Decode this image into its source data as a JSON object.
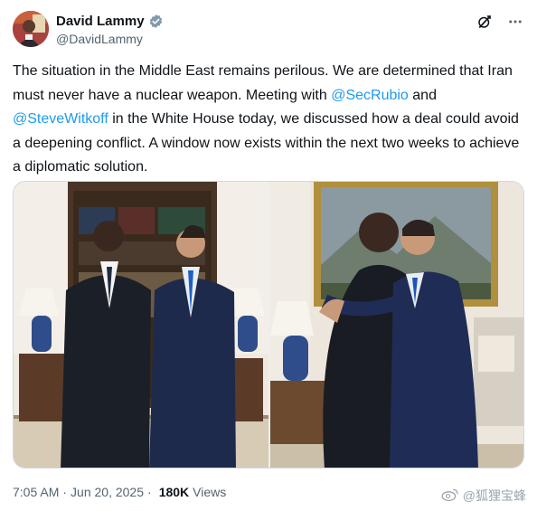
{
  "author": {
    "display_name": "David Lammy",
    "handle": "@DavidLammy",
    "verified": true,
    "avatar_icon": "profile-photo-icon"
  },
  "header_icons": [
    "grok-icon",
    "more-icon"
  ],
  "tweet": {
    "segments": [
      {
        "type": "text",
        "value": "The situation in the Middle East remains perilous. We are determined that Iran must never have a nuclear weapon. Meeting with "
      },
      {
        "type": "mention",
        "value": "@SecRubio"
      },
      {
        "type": "text",
        "value": " and "
      },
      {
        "type": "mention",
        "value": "@SteveWitkoff"
      },
      {
        "type": "text",
        "value": " in the White House today, we discussed how a deal could avoid a deepening conflict. A window now exists within the next two weeks to achieve a diplomatic solution."
      }
    ]
  },
  "media": {
    "count": 2,
    "photos": [
      "photo-1",
      "photo-2"
    ]
  },
  "meta": {
    "time": "7:05 AM",
    "separator": "·",
    "date": "Jun 20, 2025",
    "separator2": "·",
    "views_count": "180K",
    "views_label": "Views"
  },
  "watermark": {
    "text": "@狐狸宝蜂",
    "icon": "weibo-icon"
  },
  "colors": {
    "link": "#1d9bf0",
    "secondary_text": "#536471",
    "primary_text": "#0f1419",
    "border": "#cfd9de"
  }
}
